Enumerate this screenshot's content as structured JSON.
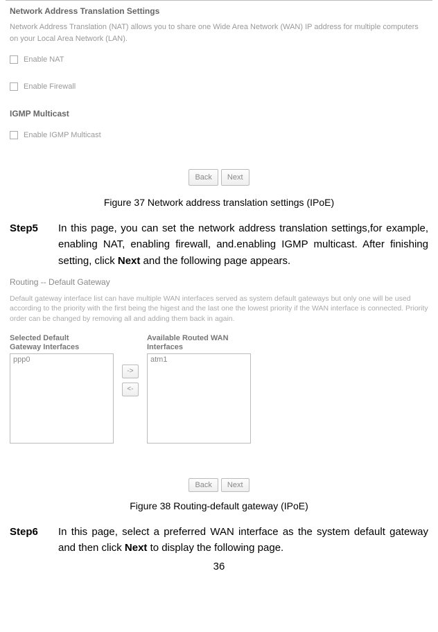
{
  "nat": {
    "title": "Network Address Translation Settings",
    "desc": "Network Address Translation (NAT) allows you to share one Wide Area Network (WAN) IP address for multiple computers on your Local Area Network (LAN).",
    "enable_nat": "Enable NAT",
    "enable_firewall": "Enable Firewall",
    "igmp_head": "IGMP Multicast",
    "enable_igmp": "Enable IGMP Multicast",
    "back": "Back",
    "next": "Next"
  },
  "fig37": "Figure 37 Network address translation settings (IPoE)",
  "step5": {
    "label": "Step5",
    "t1": "In this page, you can set the network address translation settings,for example, enabling NAT, enabling firewall, and.enabling IGMP multicast. After finishing setting, click ",
    "bold": "Next",
    "t2": " and the following page appears."
  },
  "route": {
    "title": "Routing -- Default Gateway",
    "desc": "Default gateway interface list can have multiple WAN interfaces served as system default gateways but only one will be used according to the priority with the first being the higest and the last one the lowest priority if the WAN interface is connected. Priority order can be changed by removing all and adding them back in again.",
    "sel_head": "Selected Default Gateway Interfaces",
    "avail_head": "Available Routed WAN Interfaces",
    "sel_item": "ppp0",
    "avail_item": "atm1",
    "arrow_r": "->",
    "arrow_l": "<-",
    "back": "Back",
    "next": "Next"
  },
  "fig38": "Figure 38 Routing-default gateway (IPoE)",
  "step6": {
    "label": "Step6",
    "t1": "In this page, select a preferred WAN interface as the system default gateway and then click ",
    "bold": "Next",
    "t2": " to display the following page."
  },
  "page_num": "36"
}
